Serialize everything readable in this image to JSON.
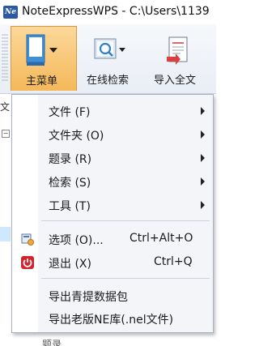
{
  "window": {
    "logo_text": "Ne",
    "title": "NoteExpressWPS - C:\\Users\\1139"
  },
  "ribbon": {
    "main_menu_label": "主菜单",
    "online_search_label": "在线检索",
    "import_fulltext_label": "导入全文"
  },
  "sidepanel": {
    "tab_label": "文",
    "expander": "⊟",
    "bottom_text": "题录"
  },
  "menu": {
    "items": [
      {
        "label": "文件 (F)"
      },
      {
        "label": "文件夹 (O)"
      },
      {
        "label": "题录 (R)"
      },
      {
        "label": "检索 (S)"
      },
      {
        "label": "工具 (T)"
      },
      {
        "label": "选项 (O)...",
        "shortcut": "Ctrl+Alt+O"
      },
      {
        "label": "退出 (X)",
        "shortcut": "Ctrl+Q"
      },
      {
        "label": "导出青提数据包"
      },
      {
        "label": "导出老版NE库(.nel文件)"
      }
    ]
  },
  "icons": {
    "app": "notexpress-logo-icon",
    "main_menu": "main-menu-icon",
    "online_search": "online-search-icon",
    "import_fulltext": "import-fulltext-icon",
    "options": "options-icon",
    "exit": "exit-power-icon"
  },
  "colors": {
    "accent": "#f5b85a",
    "exit_icon": "#d4232b",
    "logo": "#2c5aa0"
  }
}
